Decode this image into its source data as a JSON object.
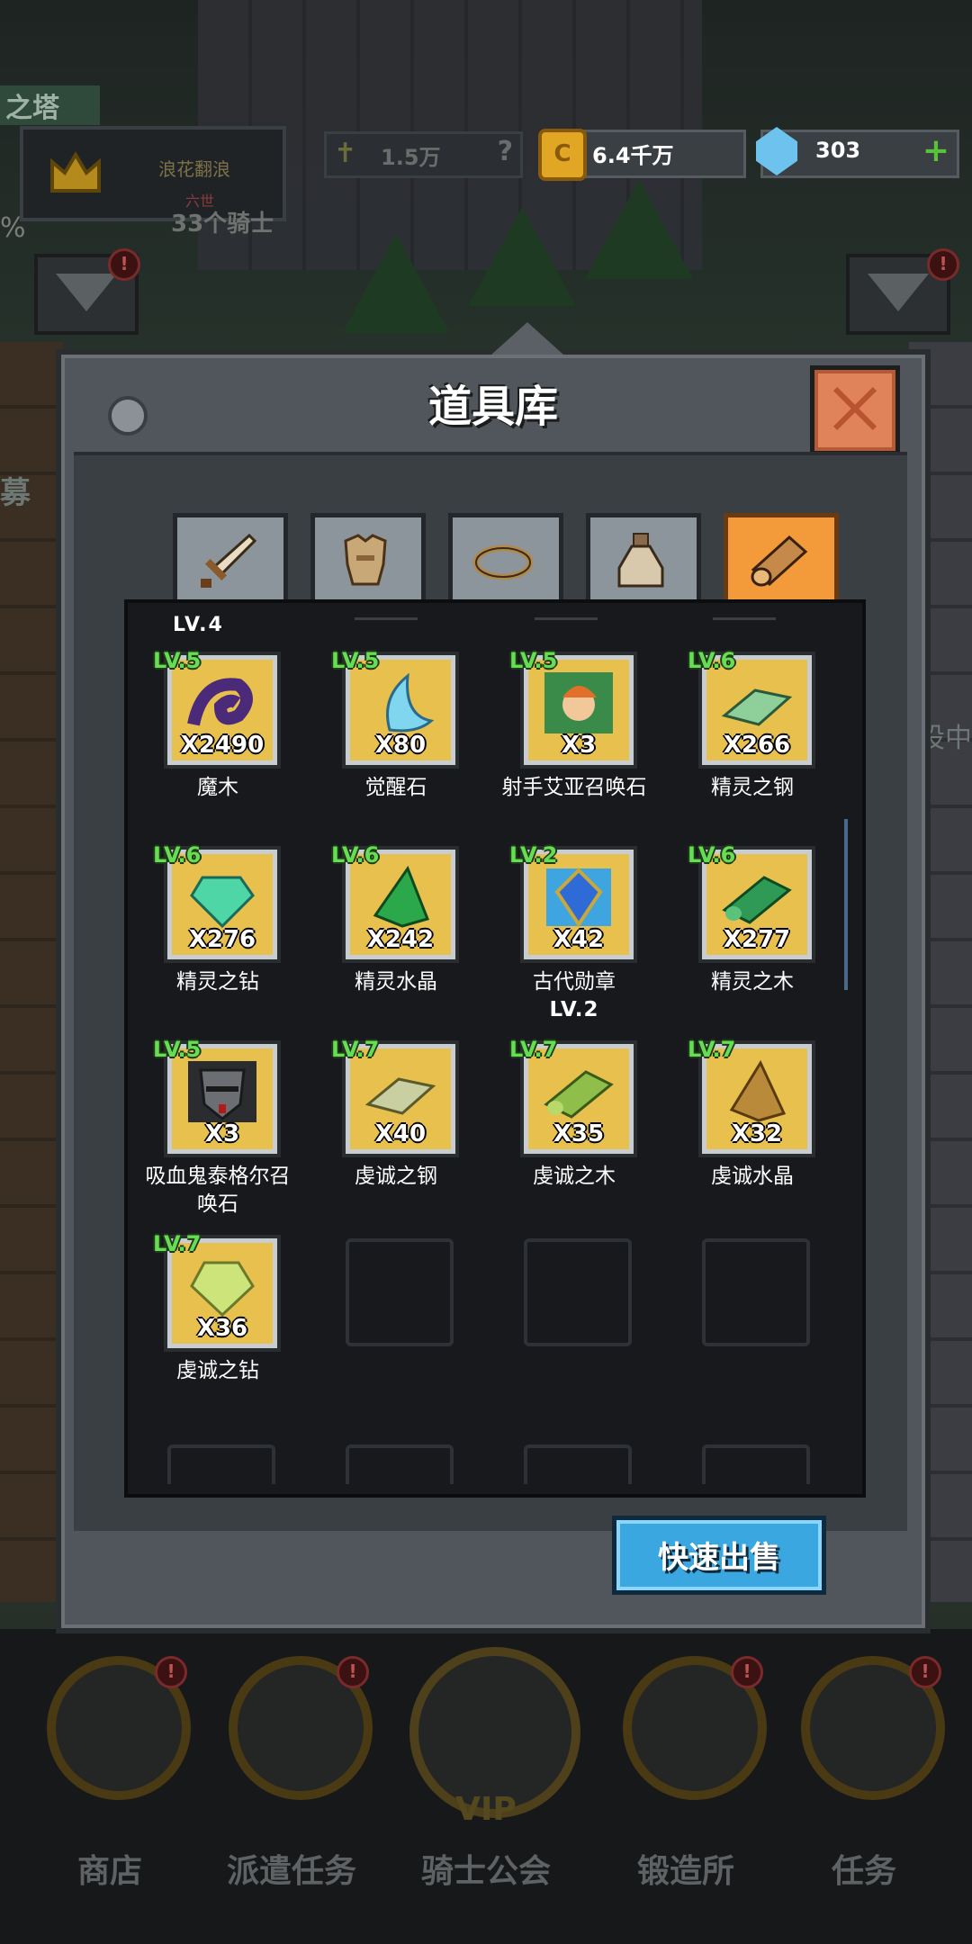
{
  "background": {
    "tower_tag": "之塔",
    "player_name": "浪花翻浪",
    "player_rank": "六世",
    "knights_text": "33个骑士",
    "percent": "%",
    "power_value": "1.5万",
    "power_help": "?",
    "gold_value": "6.4千万",
    "gold_coin": "C",
    "gem_value": "303",
    "gem_plus": "+",
    "side_right": "设中",
    "side_left": "募",
    "badge": "!"
  },
  "bottom_nav": [
    {
      "label": "商店"
    },
    {
      "label": "派遣任务"
    },
    {
      "label": "骑士公会",
      "badge": "VIP"
    },
    {
      "label": "锻造所"
    },
    {
      "label": "任务"
    }
  ],
  "modal": {
    "title": "道具库",
    "partial_label": "LV.4",
    "sell_button": "快速出售",
    "tabs": [
      {
        "name": "weapon"
      },
      {
        "name": "armor"
      },
      {
        "name": "ring"
      },
      {
        "name": "potion"
      },
      {
        "name": "material",
        "active": true
      }
    ],
    "items": [
      {
        "name": "魔木",
        "level": "LV.5",
        "qty": "X2490",
        "icon": "dark-wood-icon",
        "color": "#4b2a7a"
      },
      {
        "name": "觉醒石",
        "level": "LV.5",
        "qty": "X80",
        "icon": "awakening-stone-icon",
        "color": "#7fd6ee"
      },
      {
        "name": "射手艾亚召唤石",
        "level": "LV.5",
        "qty": "X3",
        "icon": "archer-portrait-icon",
        "color": "#3a8a4a"
      },
      {
        "name": "精灵之钢",
        "level": "LV.6",
        "qty": "X266",
        "icon": "elf-steel-icon",
        "color": "#8fcf9a"
      },
      {
        "name": "精灵之钻",
        "level": "LV.6",
        "qty": "X276",
        "icon": "elf-diamond-icon",
        "color": "#4fd6a6"
      },
      {
        "name": "精灵水晶",
        "level": "LV.6",
        "qty": "X242",
        "icon": "elf-crystal-icon",
        "color": "#2aa84a"
      },
      {
        "name": "古代勋章",
        "sub": "LV.2",
        "level": "LV.2",
        "qty": "X42",
        "icon": "ancient-medal-icon",
        "color": "#2f6bd6"
      },
      {
        "name": "精灵之木",
        "level": "LV.6",
        "qty": "X277",
        "icon": "elf-wood-icon",
        "color": "#2f9a55"
      },
      {
        "name": "吸血鬼泰格尔召唤石",
        "level": "LV.5",
        "qty": "X3",
        "icon": "vampire-portrait-icon",
        "color": "#6b6f74"
      },
      {
        "name": "虔诚之钢",
        "level": "LV.7",
        "qty": "X40",
        "icon": "pious-steel-icon",
        "color": "#c9cfa0"
      },
      {
        "name": "虔诚之木",
        "level": "LV.7",
        "qty": "X35",
        "icon": "pious-wood-icon",
        "color": "#8fbf4a"
      },
      {
        "name": "虔诚水晶",
        "level": "LV.7",
        "qty": "X32",
        "icon": "pious-crystal-icon",
        "color": "#b88a3a"
      },
      {
        "name": "虔诚之钻",
        "level": "LV.7",
        "qty": "X36",
        "icon": "pious-diamond-icon",
        "color": "#cde47a"
      }
    ]
  }
}
